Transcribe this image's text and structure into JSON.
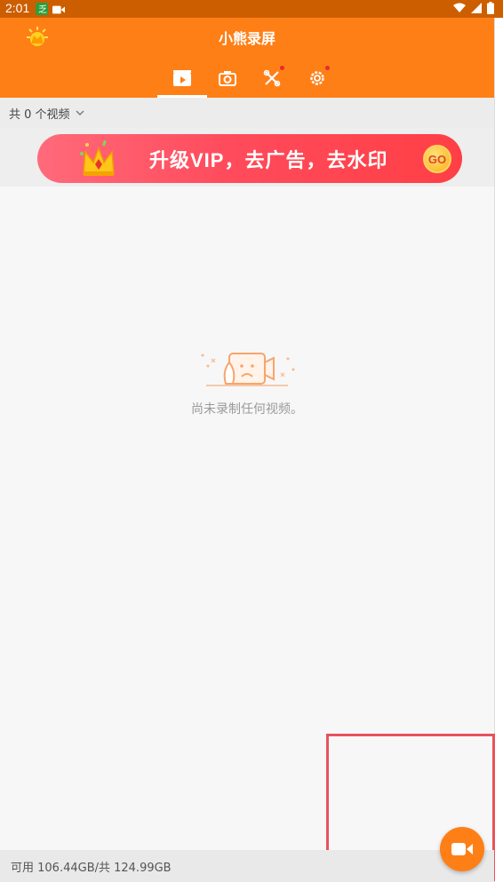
{
  "status_bar": {
    "time": "2:01"
  },
  "app": {
    "title": "小熊录屏"
  },
  "tabs": [
    {
      "name": "videos",
      "icon": "video-clapper-icon",
      "active": true,
      "badge": false
    },
    {
      "name": "screenshots",
      "icon": "camera-icon",
      "active": false,
      "badge": false
    },
    {
      "name": "tools",
      "icon": "tools-icon",
      "active": false,
      "badge": true
    },
    {
      "name": "settings",
      "icon": "gear-icon",
      "active": false,
      "badge": true
    }
  ],
  "filter": {
    "label": "共 0 个视频"
  },
  "banner": {
    "text": "升级VIP，去广告，去水印",
    "go_label": "GO"
  },
  "empty_state": {
    "message": "尚未录制任何视频。"
  },
  "footer": {
    "storage": "可用 106.44GB/共 124.99GB"
  },
  "colors": {
    "primary": "#ff7f17",
    "status_bar": "#cc5e00",
    "badge": "#e52b2b"
  }
}
